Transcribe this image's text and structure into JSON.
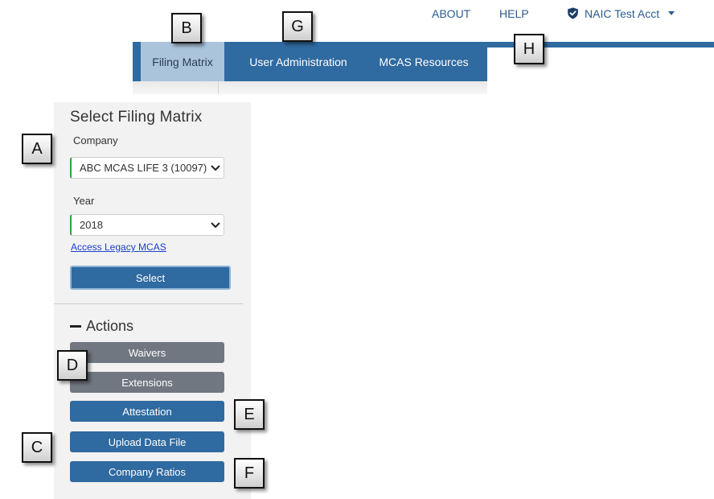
{
  "top_links": {
    "about": "ABOUT",
    "help": "HELP",
    "user": "NAIC Test Acct",
    "user_icon": "shield-check-icon",
    "dropdown_icon": "caret-down-icon"
  },
  "nav": {
    "items": [
      {
        "label": "Filing Matrix",
        "active": true
      },
      {
        "label": "User Administration",
        "active": false
      },
      {
        "label": "MCAS Resources",
        "active": false
      }
    ]
  },
  "sidebar": {
    "title": "Select Filing Matrix",
    "company_label": "Company",
    "company_value": "ABC MCAS LIFE 3 (10097)",
    "year_label": "Year",
    "year_value": "2018",
    "legacy_link": "Access Legacy MCAS",
    "select_button": "Select",
    "actions_title": "Actions",
    "actions": [
      {
        "label": "Waivers",
        "style": "gray"
      },
      {
        "label": "Extensions",
        "style": "gray"
      },
      {
        "label": "Attestation",
        "style": "blue"
      },
      {
        "label": "Upload Data File",
        "style": "blue"
      },
      {
        "label": "Company Ratios",
        "style": "blue"
      }
    ]
  },
  "callouts": [
    "A",
    "B",
    "C",
    "D",
    "E",
    "F",
    "G",
    "H"
  ],
  "colors": {
    "nav_blue": "#2f6aa0",
    "nav_active": "#aac4dc",
    "action_gray": "#707781",
    "focus_green": "#2e9e4a",
    "link_blue": "#1a3fd0"
  }
}
